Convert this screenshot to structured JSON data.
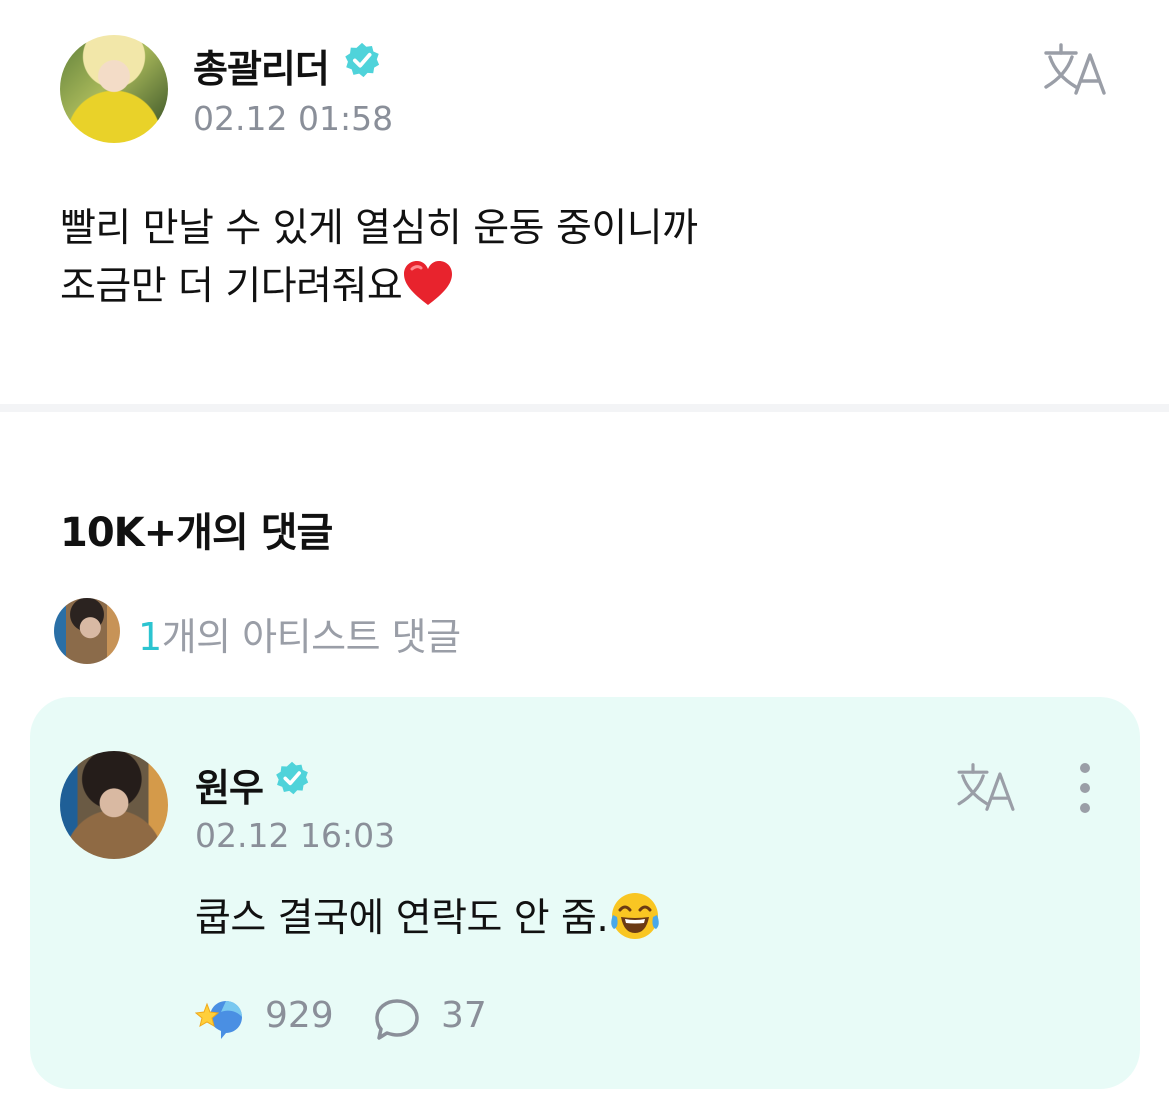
{
  "post": {
    "author": "총괄리더",
    "timestamp": "02.12 01:58",
    "body_lines": [
      "빨리 만날 수 있게 열심히 운동 중이니까",
      "조금만 더 기다려줘요"
    ],
    "body_emoji_icon": "red-heart-icon",
    "translate_icon": "translate-icon"
  },
  "comments": {
    "count_label": "10K+개의 댓글",
    "artist_comment_count": "1",
    "artist_comment_label": "개의 아티스트 댓글"
  },
  "artist_comment": {
    "author": "원우",
    "timestamp": "02.12 16:03",
    "text": "쿱스 결국에 연락도 안 줌.",
    "text_emoji_icon": "tears-of-joy-icon",
    "like_count": "929",
    "reply_count": "37",
    "like_icon": "sparkle-like-icon",
    "reply_icon": "speech-bubble-icon",
    "more_icon": "vertical-dots-icon"
  },
  "colors": {
    "accent": "#2bc4d0",
    "verified_badge": "#4fd3da",
    "card_background": "#e8fbf7",
    "muted_text": "#8a8f99",
    "divider": "#f3f4f6"
  }
}
